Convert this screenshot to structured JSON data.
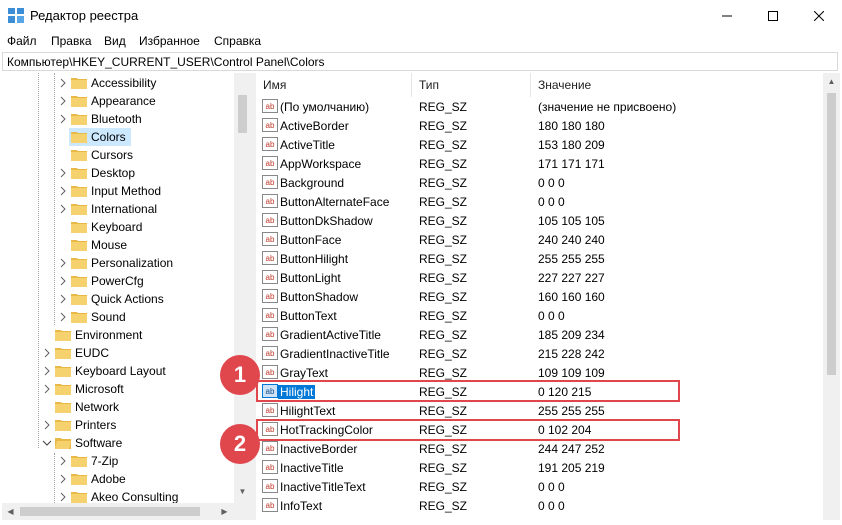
{
  "window": {
    "title": "Редактор реестра"
  },
  "menu": [
    "Файл",
    "Правка",
    "Вид",
    "Избранное",
    "Справка"
  ],
  "address": "Компьютер\\HKEY_CURRENT_USER\\Control Panel\\Colors",
  "tree": {
    "level2": [
      "Accessibility",
      "Appearance",
      "Bluetooth",
      "Colors",
      "Cursors",
      "Desktop",
      "Input Method",
      "International",
      "Keyboard",
      "Mouse",
      "Personalization",
      "PowerCfg",
      "Quick Actions",
      "Sound"
    ],
    "level1": [
      "Environment",
      "EUDC",
      "Keyboard Layout",
      "Microsoft",
      "Network",
      "Printers",
      "Software"
    ],
    "software_children": [
      "7-Zip",
      "Adobe",
      "Akeo Consulting"
    ],
    "selected": "Colors"
  },
  "columns": {
    "name": "Имя",
    "type": "Тип",
    "value": "Значение"
  },
  "rows": [
    {
      "name": "(По умолчанию)",
      "type": "REG_SZ",
      "value": "(значение не присвоено)"
    },
    {
      "name": "ActiveBorder",
      "type": "REG_SZ",
      "value": "180 180 180"
    },
    {
      "name": "ActiveTitle",
      "type": "REG_SZ",
      "value": "153 180 209"
    },
    {
      "name": "AppWorkspace",
      "type": "REG_SZ",
      "value": "171 171 171"
    },
    {
      "name": "Background",
      "type": "REG_SZ",
      "value": "0 0 0"
    },
    {
      "name": "ButtonAlternateFace",
      "type": "REG_SZ",
      "value": "0 0 0"
    },
    {
      "name": "ButtonDkShadow",
      "type": "REG_SZ",
      "value": "105 105 105"
    },
    {
      "name": "ButtonFace",
      "type": "REG_SZ",
      "value": "240 240 240"
    },
    {
      "name": "ButtonHilight",
      "type": "REG_SZ",
      "value": "255 255 255"
    },
    {
      "name": "ButtonLight",
      "type": "REG_SZ",
      "value": "227 227 227"
    },
    {
      "name": "ButtonShadow",
      "type": "REG_SZ",
      "value": "160 160 160"
    },
    {
      "name": "ButtonText",
      "type": "REG_SZ",
      "value": "0 0 0"
    },
    {
      "name": "GradientActiveTitle",
      "type": "REG_SZ",
      "value": "185 209 234"
    },
    {
      "name": "GradientInactiveTitle",
      "type": "REG_SZ",
      "value": "215 228 242"
    },
    {
      "name": "GrayText",
      "type": "REG_SZ",
      "value": "109 109 109"
    },
    {
      "name": "Hilight",
      "type": "REG_SZ",
      "value": "0 120 215"
    },
    {
      "name": "HilightText",
      "type": "REG_SZ",
      "value": "255 255 255"
    },
    {
      "name": "HotTrackingColor",
      "type": "REG_SZ",
      "value": "0 102 204"
    },
    {
      "name": "InactiveBorder",
      "type": "REG_SZ",
      "value": "244 247 252"
    },
    {
      "name": "InactiveTitle",
      "type": "REG_SZ",
      "value": "191 205 219"
    },
    {
      "name": "InactiveTitleText",
      "type": "REG_SZ",
      "value": "0 0 0"
    },
    {
      "name": "InfoText",
      "type": "REG_SZ",
      "value": "0 0 0"
    }
  ],
  "selected_row": "Hilight",
  "annotations": [
    "1",
    "2"
  ],
  "colors": {
    "accent": "#0078d7",
    "annotation": "#e0474c",
    "tree_selection": "#cce8ff",
    "folder": "#e8b947"
  }
}
